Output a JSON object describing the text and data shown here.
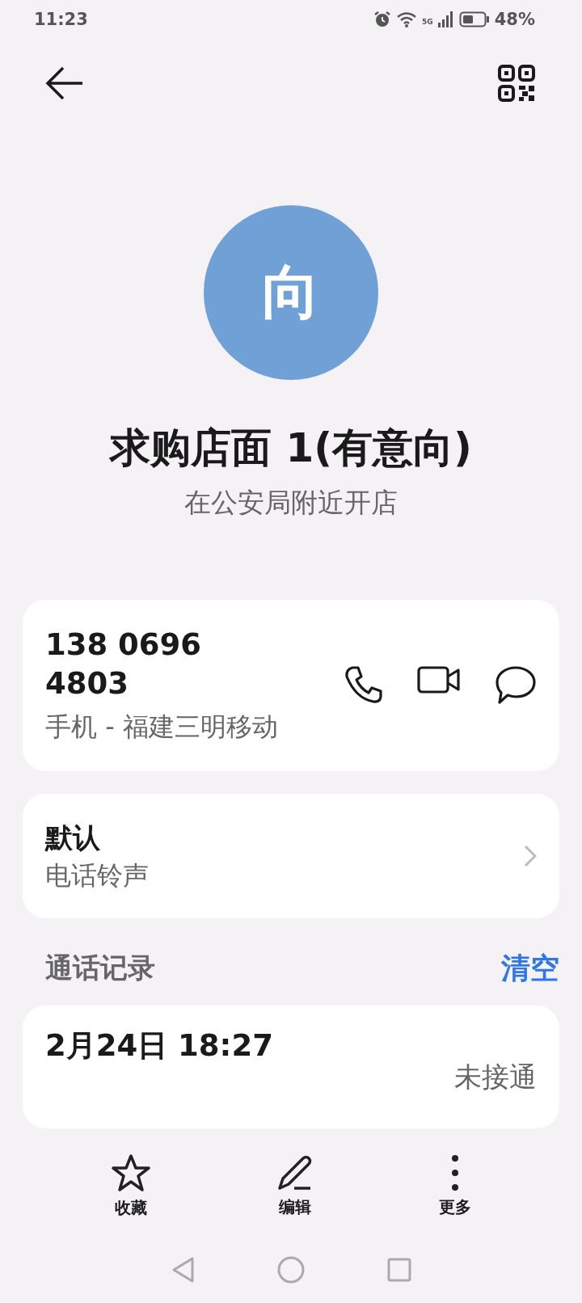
{
  "status_bar": {
    "time": "11:23",
    "network": "5G",
    "battery": "48%"
  },
  "contact": {
    "avatar_letter": "向",
    "name": "求购店面 1(有意向)",
    "note": "在公安局附近开店"
  },
  "phone_card": {
    "number": "138 0696 4803",
    "label": "手机 - 福建三明移动"
  },
  "ringtone_card": {
    "value": "默认",
    "label": "电话铃声"
  },
  "call_log": {
    "title": "通话记录",
    "clear": "清空",
    "entries": [
      {
        "time": "2月24日 18:27",
        "status": "未接通"
      }
    ]
  },
  "bottom_actions": [
    {
      "kind": "favorite",
      "label": "收藏"
    },
    {
      "kind": "edit",
      "label": "编辑"
    },
    {
      "kind": "more",
      "label": "更多"
    }
  ]
}
